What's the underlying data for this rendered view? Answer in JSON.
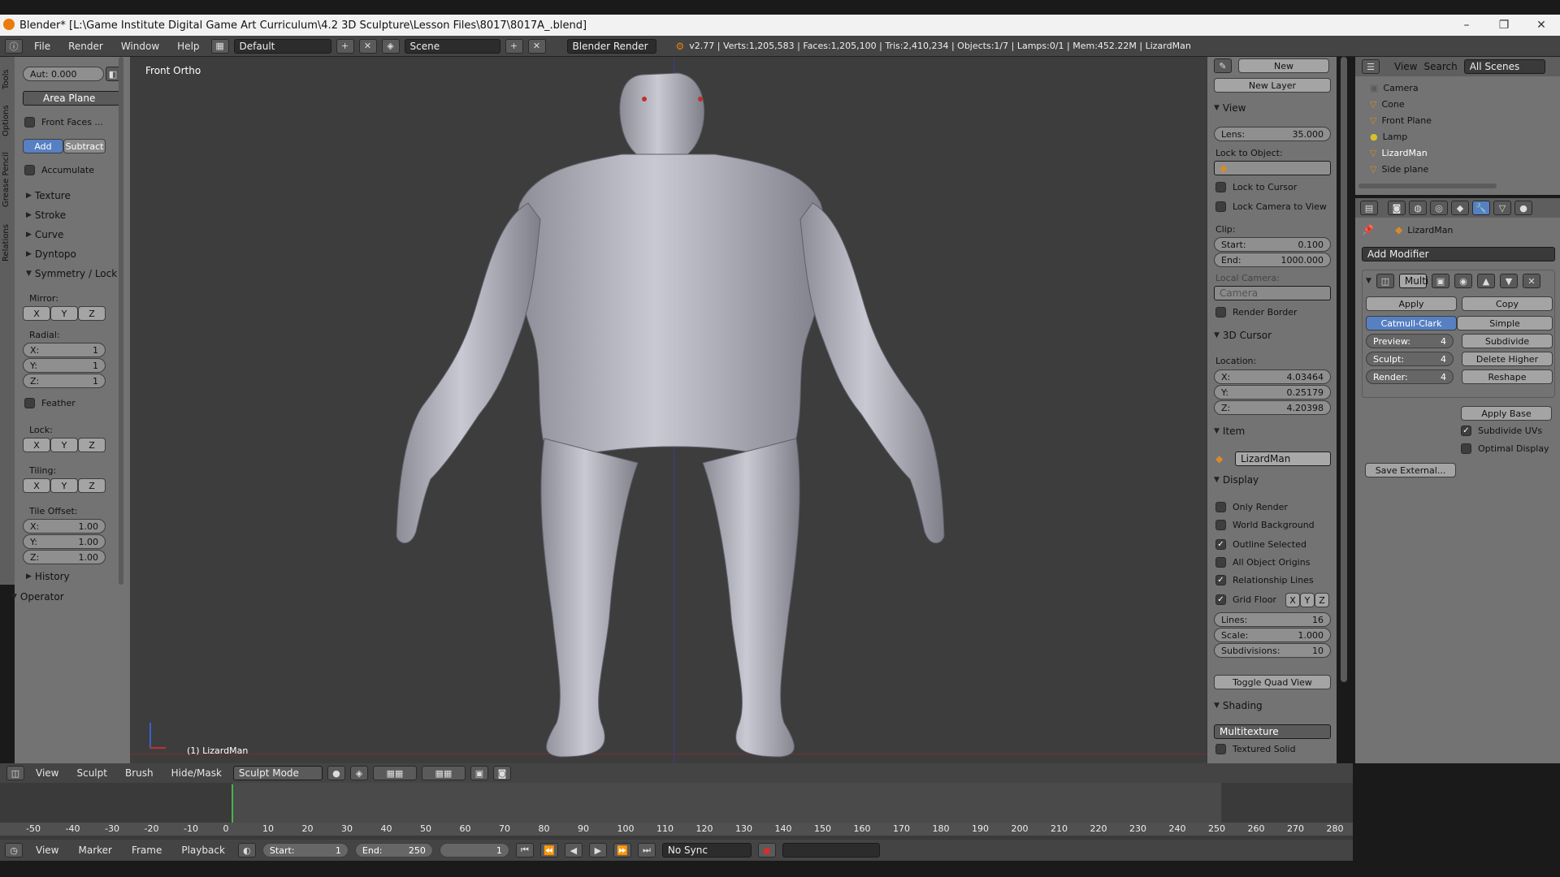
{
  "window": {
    "title": "Blender* [L:\\Game Institute Digital Game Art  Curriculum\\4.2 3D Sculpture\\Lesson Files\\8017\\8017A_.blend]",
    "minimize": "–",
    "maximize": "❐",
    "close": "✕"
  },
  "infobar": {
    "menus": [
      "File",
      "Render",
      "Window",
      "Help"
    ],
    "layout": "Default",
    "scene": "Scene",
    "engine": "Blender Render",
    "stats": "v2.77 | Verts:1,205,583 | Faces:1,205,100 | Tris:2,410,234 | Objects:1/7 | Lamps:0/1 | Mem:452.22M | LizardMan"
  },
  "tool_tabs": [
    "Tools",
    "Options",
    "Grease Pencil",
    "Relations"
  ],
  "toolshelf": {
    "autosmooth": "Aut: 0.000",
    "area_plane": "Area Plane",
    "front_faces": "Front Faces ...",
    "add": "Add",
    "subtract": "Subtract",
    "accumulate": "Accumulate",
    "sections": [
      "Texture",
      "Stroke",
      "Curve",
      "Dyntopo"
    ],
    "symmetry": "Symmetry / Lock",
    "mirror": "Mirror:",
    "radial": "Radial:",
    "radial_x": "X:",
    "radial_x_val": "1",
    "radial_y": "Y:",
    "radial_y_val": "1",
    "radial_z": "Z:",
    "radial_z_val": "1",
    "feather": "Feather",
    "lock": "Lock:",
    "tiling": "Tiling:",
    "tile_offset": "Tile Offset:",
    "to_x": "X:",
    "to_x_val": "1.00",
    "to_y": "Y:",
    "to_y_val": "1.00",
    "to_z": "Z:",
    "to_z_val": "1.00",
    "history": "History",
    "operator": "Operator",
    "axis_x": "X",
    "axis_y": "Y",
    "axis_z": "Z"
  },
  "viewport": {
    "view_label": "Front Ortho",
    "object_label": "(1) LizardMan"
  },
  "npanel": {
    "new": "New",
    "new_layer": "New Layer",
    "view": "View",
    "lens": "Lens:",
    "lens_val": "35.000",
    "lock_to_object": "Lock to Object:",
    "lock_to_cursor": "Lock to Cursor",
    "lock_camera": "Lock Camera to View",
    "clip": "Clip:",
    "clip_start": "Start:",
    "clip_start_val": "0.100",
    "clip_end": "End:",
    "clip_end_val": "1000.000",
    "local_camera": "Local Camera:",
    "camera": "Camera",
    "render_border": "Render Border",
    "cursor": "3D Cursor",
    "location": "Location:",
    "cx": "X:",
    "cx_val": "4.03464",
    "cy": "Y:",
    "cy_val": "0.25179",
    "cz": "Z:",
    "cz_val": "4.20398",
    "item": "Item",
    "item_name": "LizardMan",
    "display": "Display",
    "only_render": "Only Render",
    "world_bg": "World Background",
    "outline_selected": "Outline Selected",
    "all_origins": "All Object Origins",
    "rel_lines": "Relationship Lines",
    "grid_floor": "Grid Floor",
    "lines": "Lines:",
    "lines_val": "16",
    "scale": "Scale:",
    "scale_val": "1.000",
    "subdivisions": "Subdivisions:",
    "subdivisions_val": "10",
    "toggle_quad": "Toggle Quad View",
    "shading": "Shading",
    "multitexture": "Multitexture",
    "textured_solid": "Textured Solid"
  },
  "outliner": {
    "view": "View",
    "search": "Search",
    "scenes": "All Scenes",
    "items": [
      "Camera",
      "Cone",
      "Front Plane",
      "Lamp",
      "LizardMan",
      "Side plane"
    ]
  },
  "props": {
    "object": "LizardMan",
    "add_modifier": "Add Modifier",
    "mod_name": "Multi",
    "apply": "Apply",
    "copy": "Copy",
    "catmull": "Catmull-Clark",
    "simple": "Simple",
    "preview": "Preview:",
    "preview_val": "4",
    "sculpt": "Sculpt:",
    "sculpt_val": "4",
    "render": "Render:",
    "render_val": "4",
    "subdivide": "Subdivide",
    "delete_higher": "Delete Higher",
    "reshape": "Reshape",
    "apply_base": "Apply Base",
    "subdivide_uvs": "Subdivide UVs",
    "optimal_display": "Optimal Display",
    "save_external": "Save External..."
  },
  "vp_header": {
    "menus": [
      "View",
      "Sculpt",
      "Brush",
      "Hide/Mask"
    ],
    "mode": "Sculpt Mode"
  },
  "timeline": {
    "ticks": [
      "-50",
      "-40",
      "-30",
      "-20",
      "-10",
      "0",
      "10",
      "20",
      "30",
      "40",
      "50",
      "60",
      "70",
      "80",
      "90",
      "100",
      "110",
      "120",
      "130",
      "140",
      "150",
      "160",
      "170",
      "180",
      "190",
      "200",
      "210",
      "220",
      "230",
      "240",
      "250",
      "260",
      "270",
      "280"
    ],
    "menus": [
      "View",
      "Marker",
      "Frame",
      "Playback"
    ],
    "start": "Start:",
    "start_val": "1",
    "end": "End:",
    "end_val": "250",
    "current": "1",
    "sync": "No Sync"
  }
}
